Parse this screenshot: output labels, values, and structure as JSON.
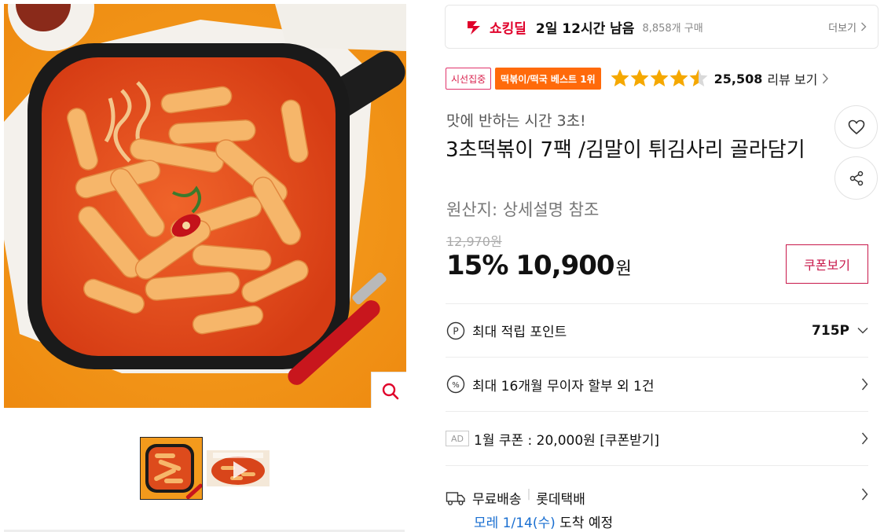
{
  "gallery": {
    "zoom_icon": "search-icon",
    "thumbnails": [
      {
        "name": "thumb-main-photo",
        "type": "image"
      },
      {
        "name": "thumb-video",
        "type": "video"
      }
    ]
  },
  "deal": {
    "label": "쇼킹딜",
    "time_left": "2일 12시간 남음",
    "purchase_count": "8,858개 구매",
    "more_label": "더보기"
  },
  "badges": {
    "focus": "시선집중",
    "best": "떡볶이/떡국 베스트 1위"
  },
  "rating": {
    "stars": 4.5,
    "max": 5,
    "review_count": "25,508",
    "review_label": "리뷰 보기"
  },
  "product": {
    "subtitle": "맛에 반하는 시간 3초!",
    "title": "3초떡볶이 7팩 /김말이 튀김사리 골라담기",
    "origin": "원산지:  상세설명 참조"
  },
  "price": {
    "original": "12,970원",
    "discount": "15%",
    "sale": "10,900",
    "currency": "원",
    "coupon_button": "쿠폰보기"
  },
  "info": {
    "points_label": "최대 적립 포인트",
    "points_value": "715P",
    "installment_label": "최대 16개월 무이자 할부 외 1건",
    "ad_tag": "AD",
    "coupon_label": "1월 쿠폰 : 20,000원 [쿠폰받기]",
    "shipping_free": "무료배송",
    "shipping_carrier": "롯데택배",
    "eta_date": "모레 1/14(수)",
    "eta_suffix": " 도착 예정"
  },
  "colors": {
    "accent_red": "#e0002a",
    "coupon_border": "#c8184a",
    "best_badge": "#ff6a0a",
    "star": "#f5a800",
    "eta_blue": "#1a6fd1"
  }
}
